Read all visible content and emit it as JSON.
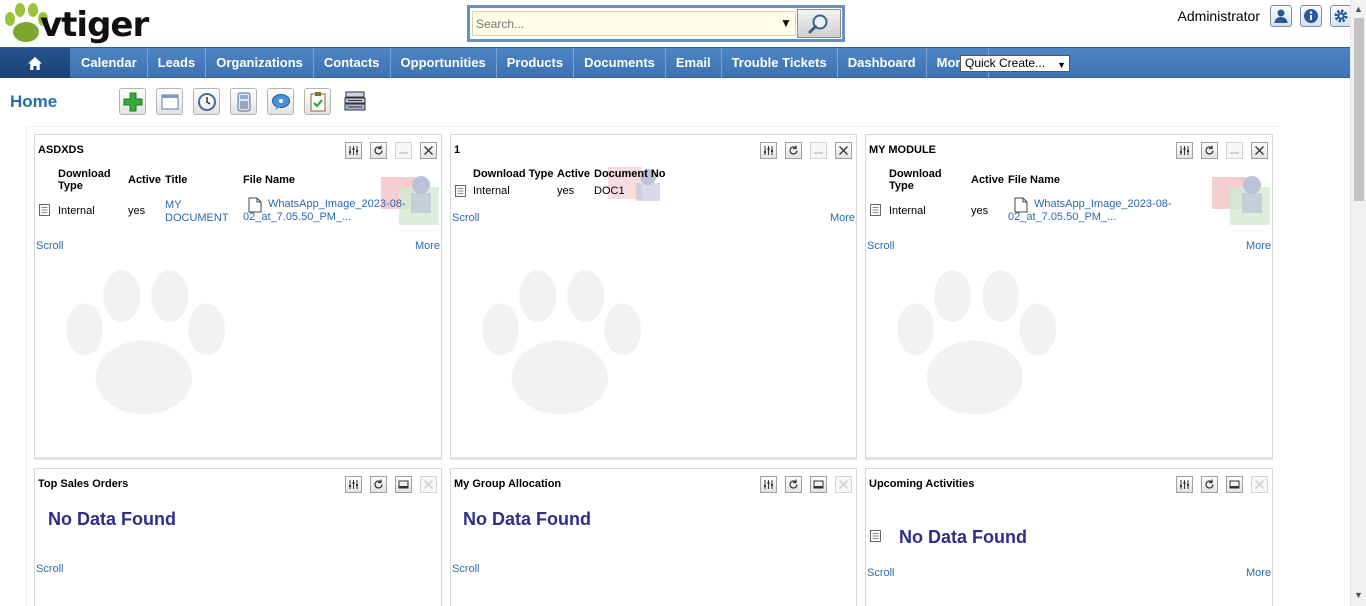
{
  "brand": {
    "name": "vtiger"
  },
  "search": {
    "placeholder": "Search..."
  },
  "header": {
    "user": "Administrator"
  },
  "nav": {
    "items": [
      "Calendar",
      "Leads",
      "Organizations",
      "Contacts",
      "Opportunities",
      "Products",
      "Documents",
      "Email",
      "Trouble Tickets",
      "Dashboard",
      "More ▾"
    ],
    "quick_create": "Quick Create..."
  },
  "page": {
    "title": "Home"
  },
  "common": {
    "scroll": "Scroll",
    "more": "More",
    "no_data": "No Data Found"
  },
  "widgets": {
    "asdxds": {
      "title": "ASDXDS",
      "h_download": "Download Type",
      "h_active": "Active",
      "h_title": "Title",
      "h_file": "File Name",
      "download": "Internal",
      "active": "yes",
      "title_val": "MY DOCUMENT",
      "file": "WhatsApp_Image_2023-08-02_at_7.05.50_PM_..."
    },
    "one": {
      "title": "1",
      "h_download": "Download Type",
      "h_active": "Active",
      "h_docno": "Document No",
      "download": "Internal",
      "active": "yes",
      "docno": "DOC1"
    },
    "mymodule": {
      "title": "MY MODULE",
      "h_download": "Download Type",
      "h_active": "Active",
      "h_file": "File Name",
      "download": "Internal",
      "active": "yes",
      "file": "WhatsApp_Image_2023-08-02_at_7.05.50_PM_..."
    },
    "sales": {
      "title": "Top Sales Orders"
    },
    "group": {
      "title": "My Group Allocation"
    },
    "upcoming": {
      "title": "Upcoming Activities"
    }
  }
}
